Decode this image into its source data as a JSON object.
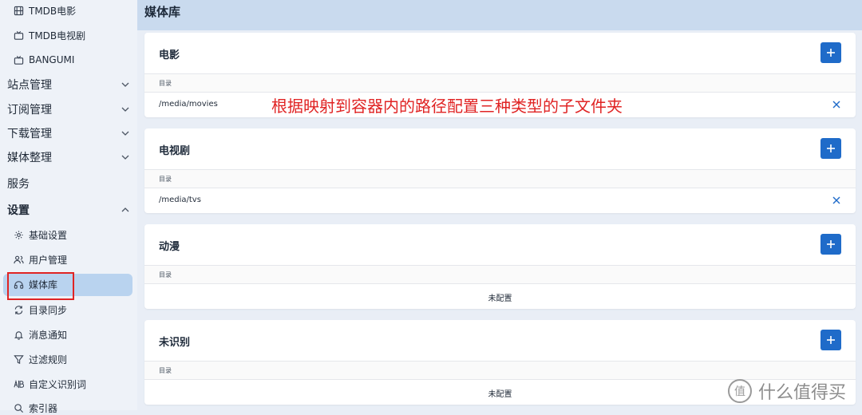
{
  "sidebar": {
    "items_top": [
      {
        "label": "TMDB电影",
        "icon": "film-icon"
      },
      {
        "label": "TMDB电视剧",
        "icon": "tv-icon"
      },
      {
        "label": "BANGUMI",
        "icon": "tv-icon"
      }
    ],
    "groups": [
      {
        "label": "站点管理",
        "expanded": false
      },
      {
        "label": "订阅管理",
        "expanded": false
      },
      {
        "label": "下载管理",
        "expanded": false
      },
      {
        "label": "媒体整理",
        "expanded": false
      },
      {
        "label": "服务"
      },
      {
        "label": "设置",
        "expanded": true
      }
    ],
    "settings_items": [
      {
        "label": "基础设置",
        "icon": "gear-icon"
      },
      {
        "label": "用户管理",
        "icon": "users-icon"
      },
      {
        "label": "媒体库",
        "icon": "library-icon",
        "active": true
      },
      {
        "label": "目录同步",
        "icon": "sync-icon"
      },
      {
        "label": "消息通知",
        "icon": "bell-icon"
      },
      {
        "label": "过滤规则",
        "icon": "filter-icon"
      },
      {
        "label": "自定义识别词",
        "icon": "ab-icon"
      },
      {
        "label": "索引器",
        "icon": "indexer-icon"
      }
    ]
  },
  "main": {
    "title": "媒体库",
    "cards": [
      {
        "title": "电影",
        "column": "目录",
        "paths": [
          "/media/movies"
        ]
      },
      {
        "title": "电视剧",
        "column": "目录",
        "paths": [
          "/media/tvs"
        ]
      },
      {
        "title": "动漫",
        "column": "目录",
        "empty_text": "未配置"
      },
      {
        "title": "未识别",
        "column": "目录",
        "empty_text": "未配置"
      }
    ]
  },
  "annotation": "根据映射到容器内的路径配置三种类型的子文件夹",
  "watermark": {
    "logo": "值",
    "text": "什么值得买"
  },
  "colors": {
    "accent": "#1f6bc9",
    "annotation": "#e02424",
    "active_bg": "#b9d3ef"
  }
}
